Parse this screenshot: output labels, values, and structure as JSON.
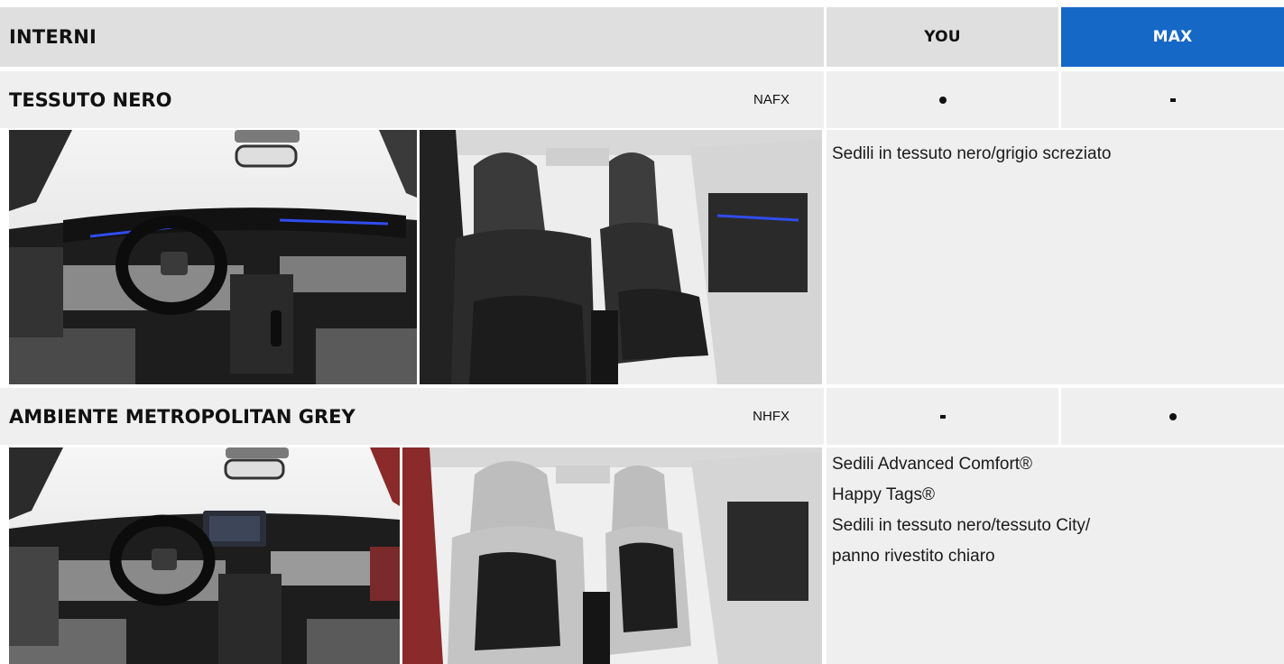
{
  "header": {
    "title": "INTERNI",
    "columns": [
      "YOU",
      "MAX"
    ],
    "max_color": "#1668c7"
  },
  "rows": [
    {
      "name": "TESSUTO NERO",
      "code": "NAFX",
      "you": "dot",
      "max": "dash",
      "description": [
        "Sedili in tessuto nero/grigio screziato"
      ],
      "images": [
        "dashboard-interior-black",
        "front-seats-black-fabric"
      ]
    },
    {
      "name": "AMBIENTE METROPOLITAN GREY",
      "code": "NHFX",
      "you": "dash",
      "max": "dot",
      "description": [
        "Sedili Advanced Comfort®",
        "Happy Tags®",
        "Sedili in tessuto nero/tessuto City/",
        "panno rivestito chiaro"
      ],
      "images": [
        "dashboard-interior-grey",
        "front-seats-grey-fabric"
      ]
    }
  ]
}
